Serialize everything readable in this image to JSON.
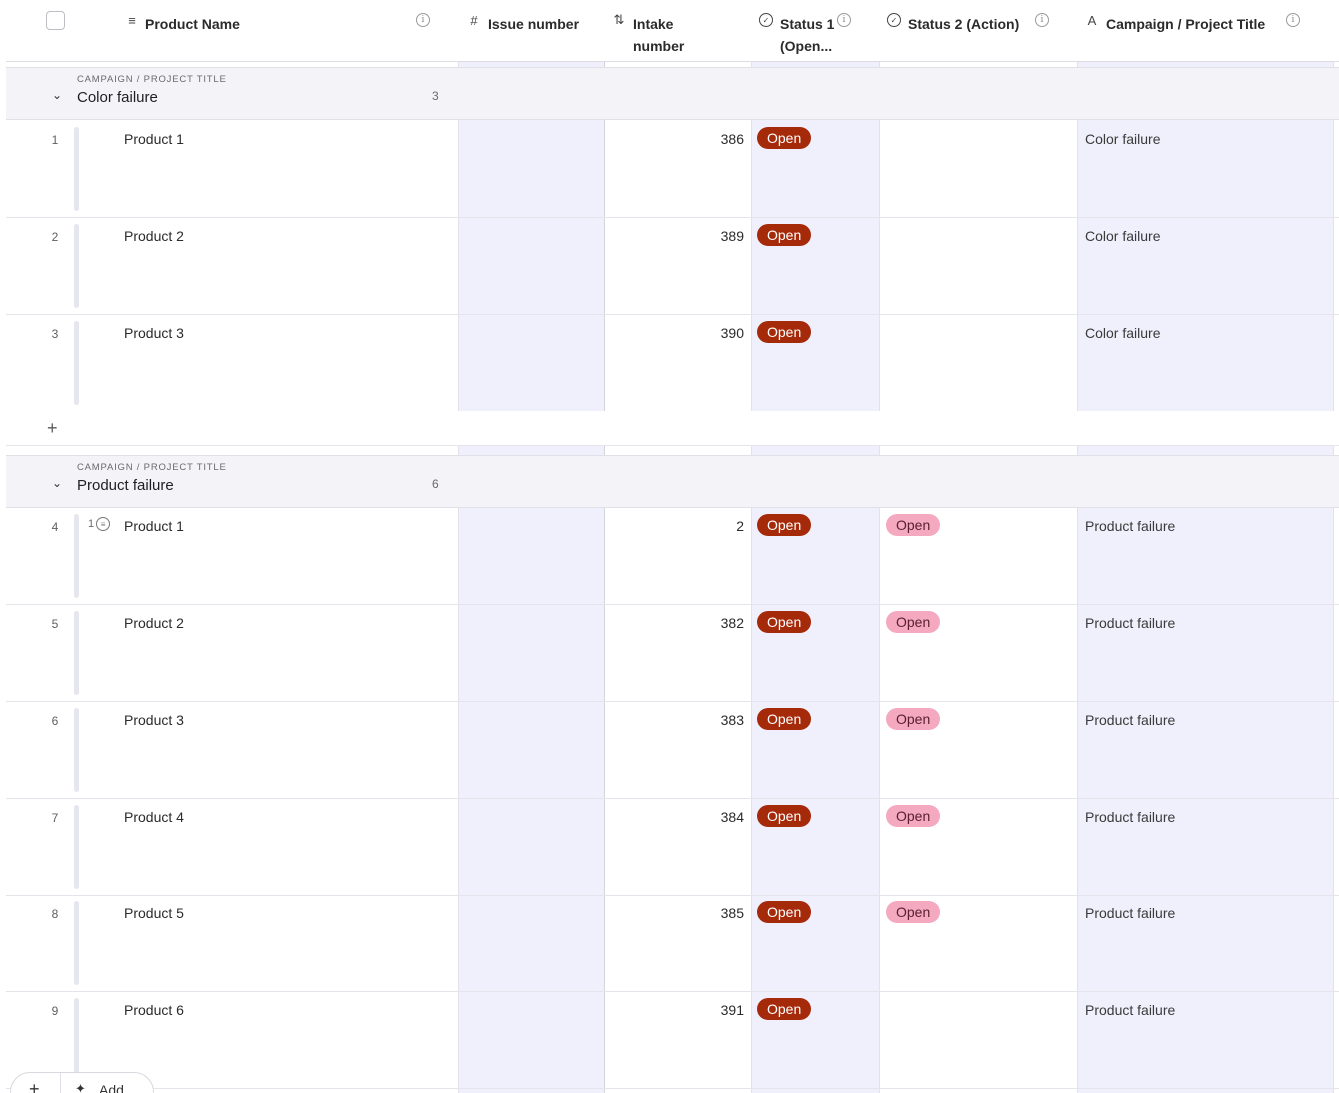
{
  "columns": {
    "product_name": "Product Name",
    "issue_number": "Issue number",
    "intake_line1": "Intake",
    "intake_line2": "number",
    "status1_line1": "Status 1",
    "status1_line2": "(Open...",
    "status2": "Status 2 (Action)",
    "campaign": "Campaign / Project Title"
  },
  "icons": {
    "product_name": "text-icon",
    "issue_number": "hash-icon",
    "intake": "sort-number-icon",
    "status": "status-circle-icon",
    "campaign": "text-a-icon",
    "info": "info-icon"
  },
  "colors": {
    "status_dark": "#a52a0a",
    "status_light": "#f4a9c0",
    "highlight_column": "#f0effc"
  },
  "groups": [
    {
      "kicker": "CAMPAIGN / PROJECT TITLE",
      "title": "Color failure",
      "count": "3",
      "rows": [
        {
          "num": "1",
          "name": "Product 1",
          "intake": "386",
          "status1": "Open",
          "status2": "",
          "campaign": "Color failure",
          "comments": ""
        },
        {
          "num": "2",
          "name": "Product 2",
          "intake": "389",
          "status1": "Open",
          "status2": "",
          "campaign": "Color failure",
          "comments": ""
        },
        {
          "num": "3",
          "name": "Product 3",
          "intake": "390",
          "status1": "Open",
          "status2": "",
          "campaign": "Color failure",
          "comments": ""
        }
      ]
    },
    {
      "kicker": "CAMPAIGN / PROJECT TITLE",
      "title": "Product failure",
      "count": "6",
      "rows": [
        {
          "num": "4",
          "name": "Product 1",
          "intake": "2",
          "status1": "Open",
          "status2": "Open",
          "campaign": "Product failure",
          "comments": "1"
        },
        {
          "num": "5",
          "name": "Product 2",
          "intake": "382",
          "status1": "Open",
          "status2": "Open",
          "campaign": "Product failure",
          "comments": ""
        },
        {
          "num": "6",
          "name": "Product 3",
          "intake": "383",
          "status1": "Open",
          "status2": "Open",
          "campaign": "Product failure",
          "comments": ""
        },
        {
          "num": "7",
          "name": "Product 4",
          "intake": "384",
          "status1": "Open",
          "status2": "Open",
          "campaign": "Product failure",
          "comments": ""
        },
        {
          "num": "8",
          "name": "Product 5",
          "intake": "385",
          "status1": "Open",
          "status2": "Open",
          "campaign": "Product failure",
          "comments": ""
        },
        {
          "num": "9",
          "name": "Product 6",
          "intake": "391",
          "status1": "Open",
          "status2": "",
          "campaign": "Product failure",
          "comments": ""
        }
      ]
    }
  ],
  "footer": {
    "add_label": "Add"
  }
}
